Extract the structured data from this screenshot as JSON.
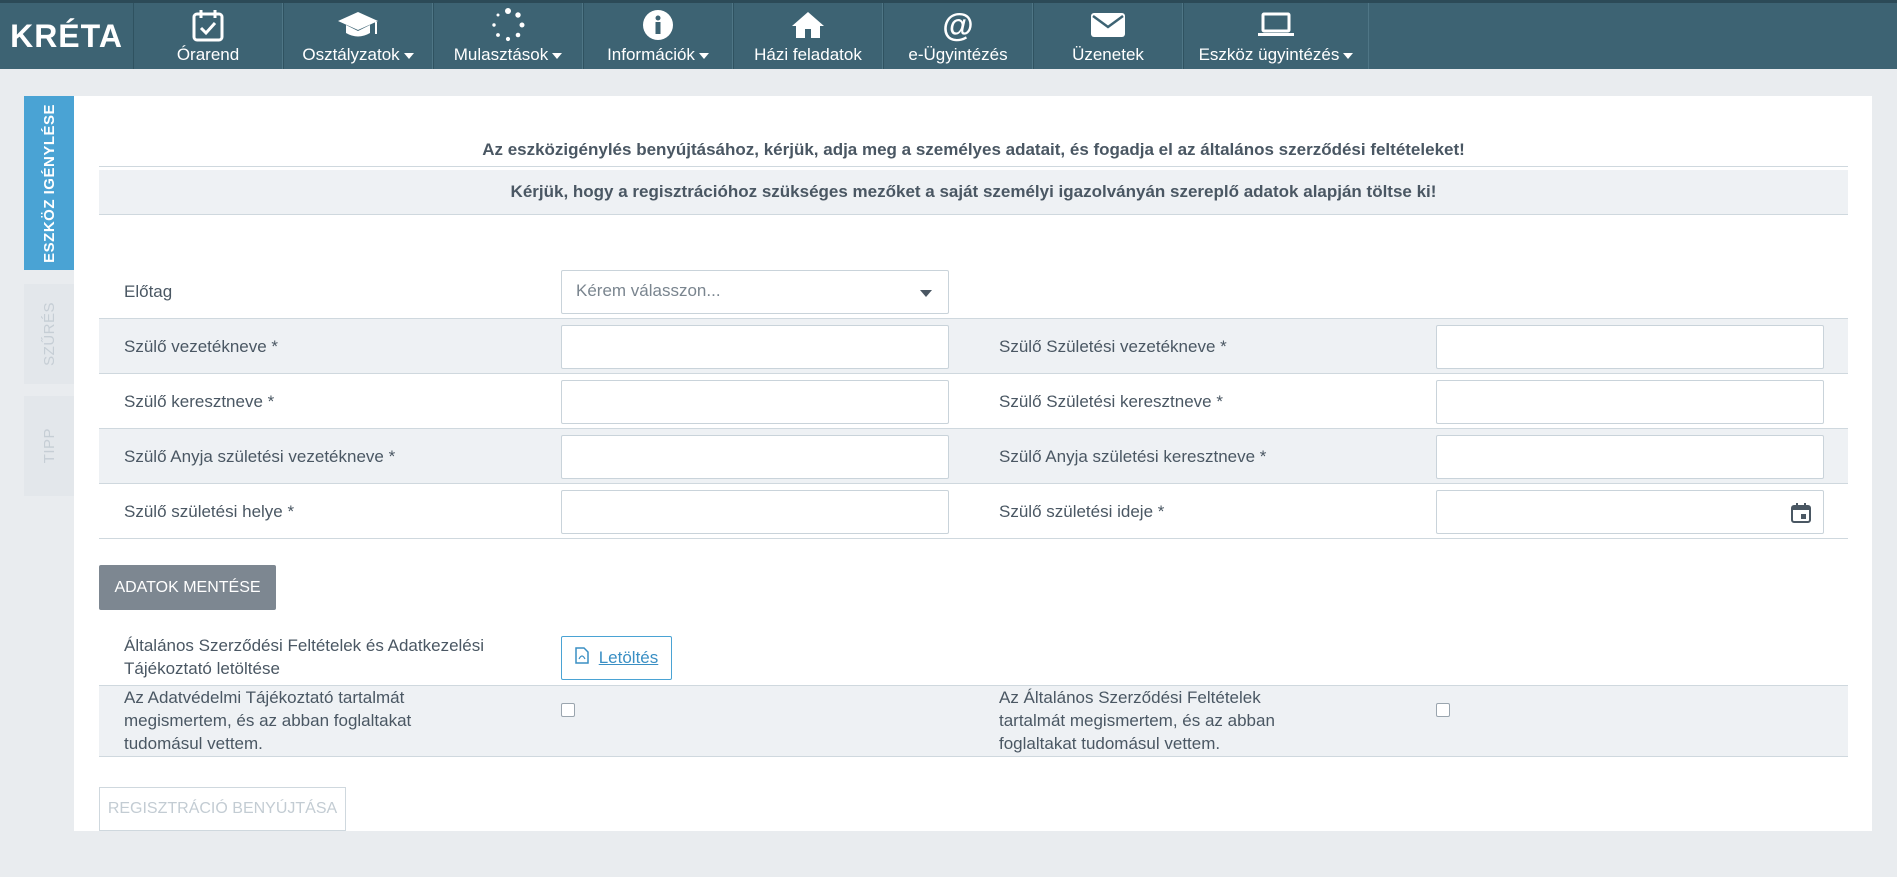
{
  "brand": {
    "logo_text": "KRÉTA"
  },
  "nav": {
    "items": [
      {
        "label": "Órarend",
        "icon": "calendar-check-icon",
        "caret": false
      },
      {
        "label": "Osztályzatok",
        "icon": "graduation-cap-icon",
        "caret": true
      },
      {
        "label": "Mulasztások",
        "icon": "spinner-icon",
        "caret": true
      },
      {
        "label": "Információk",
        "icon": "info-circle-icon",
        "caret": true
      },
      {
        "label": "Házi feladatok",
        "icon": "home-icon",
        "caret": false
      },
      {
        "label": "e-Ügyintézés",
        "icon": "at-sign-icon",
        "caret": false
      },
      {
        "label": "Üzenetek",
        "icon": "envelope-icon",
        "caret": false
      },
      {
        "label": "Eszköz ügyintézés",
        "icon": "laptop-icon",
        "caret": true
      }
    ]
  },
  "side_tabs": {
    "active": "ESZKÖZ IGÉNYLÉSE",
    "filter": "SZŰRÉS",
    "tip": "TIPP"
  },
  "info": {
    "line1": "Az eszközigénylés benyújtásához, kérjük, adja meg a személyes adatait, és fogadja el az általános szerződési feltételeket!",
    "line2": "Kérjük, hogy a regisztrációhoz szükséges mezőket a saját személyi igazolványán szereplő adatok alapján töltse ki!"
  },
  "form": {
    "prefix_label": "Előtag",
    "prefix_placeholder": "Kérem válasszon...",
    "parent_lastname": "Szülő vezetékneve *",
    "parent_birth_lastname": "Szülő Születési vezetékneve *",
    "parent_firstname": "Szülő keresztneve *",
    "parent_birth_firstname": "Szülő Születési keresztneve *",
    "mother_birth_lastname": "Szülő Anyja születési vezetékneve *",
    "mother_birth_firstname": "Szülő Anyja születési keresztneve *",
    "birth_place": "Szülő születési helye *",
    "birth_date": "Szülő születési ideje *",
    "save_button": "ADATOK MENTÉSE",
    "terms_download_label": "Általános Szerződési Feltételek és Adatkezelési Tájékoztató letöltése",
    "download_button": "Letöltés",
    "privacy_ack": "Az Adatvédelmi Tájékoztató tartalmát megismertem, és az abban foglaltakat tudomásul vettem.",
    "terms_ack": "Az Általános Szerződési Feltételek tartalmát megismertem, és az abban foglaltakat tudomásul vettem.",
    "submit_button": "REGISZTRÁCIÓ BENYÚJTÁSA"
  },
  "colors": {
    "topbar": "#3d6373",
    "active_tab": "#4aa3d4",
    "save_button": "#7d8791",
    "link": "#3a8fc4"
  }
}
